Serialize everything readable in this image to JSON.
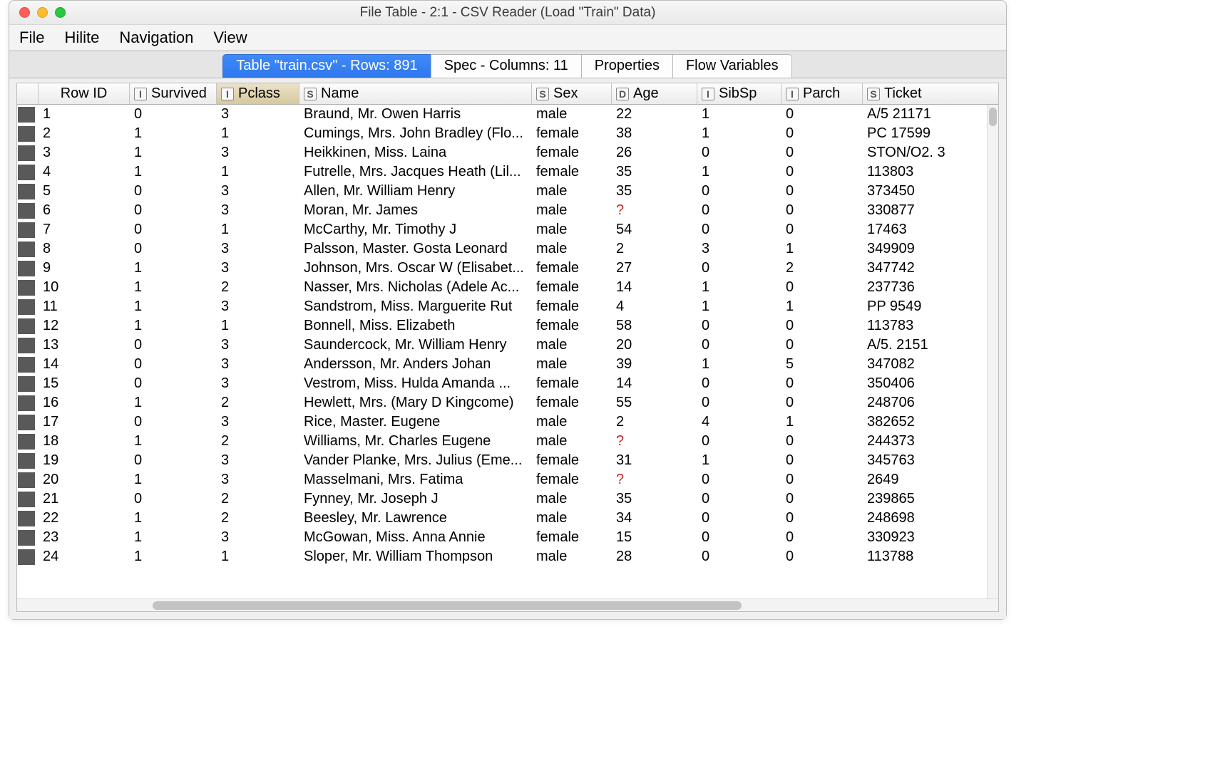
{
  "window": {
    "title": "File Table - 2:1 - CSV Reader (Load \"Train\" Data)"
  },
  "menubar": {
    "items": [
      "File",
      "Hilite",
      "Navigation",
      "View"
    ]
  },
  "tabs": [
    {
      "label": "Table \"train.csv\" - Rows: 891",
      "active": true
    },
    {
      "label": "Spec - Columns: 11",
      "active": false
    },
    {
      "label": "Properties",
      "active": false
    },
    {
      "label": "Flow Variables",
      "active": false
    }
  ],
  "columns": {
    "rowid": {
      "label": "Row ID"
    },
    "survived": {
      "type": "I",
      "label": "Survived"
    },
    "pclass": {
      "type": "I",
      "label": "Pclass",
      "sorted": true
    },
    "name": {
      "type": "S",
      "label": "Name"
    },
    "sex": {
      "type": "S",
      "label": "Sex"
    },
    "age": {
      "type": "D",
      "label": "Age"
    },
    "sibsp": {
      "type": "I",
      "label": "SibSp"
    },
    "parch": {
      "type": "I",
      "label": "Parch"
    },
    "ticket": {
      "type": "S",
      "label": "Ticket"
    }
  },
  "missing_marker": "?",
  "row_count": 891,
  "rows": [
    {
      "rowid": "1",
      "survived": "0",
      "pclass": "3",
      "name": "Braund, Mr. Owen Harris",
      "sex": "male",
      "age": "22",
      "sibsp": "1",
      "parch": "0",
      "ticket": "A/5 21171"
    },
    {
      "rowid": "2",
      "survived": "1",
      "pclass": "1",
      "name": "Cumings, Mrs. John Bradley (Flo...",
      "sex": "female",
      "age": "38",
      "sibsp": "1",
      "parch": "0",
      "ticket": "PC 17599"
    },
    {
      "rowid": "3",
      "survived": "1",
      "pclass": "3",
      "name": "Heikkinen, Miss. Laina",
      "sex": "female",
      "age": "26",
      "sibsp": "0",
      "parch": "0",
      "ticket": "STON/O2. 3"
    },
    {
      "rowid": "4",
      "survived": "1",
      "pclass": "1",
      "name": "Futrelle, Mrs. Jacques Heath (Lil...",
      "sex": "female",
      "age": "35",
      "sibsp": "1",
      "parch": "0",
      "ticket": "113803"
    },
    {
      "rowid": "5",
      "survived": "0",
      "pclass": "3",
      "name": "Allen, Mr. William Henry",
      "sex": "male",
      "age": "35",
      "sibsp": "0",
      "parch": "0",
      "ticket": "373450"
    },
    {
      "rowid": "6",
      "survived": "0",
      "pclass": "3",
      "name": "Moran, Mr. James",
      "sex": "male",
      "age": null,
      "sibsp": "0",
      "parch": "0",
      "ticket": "330877"
    },
    {
      "rowid": "7",
      "survived": "0",
      "pclass": "1",
      "name": "McCarthy, Mr. Timothy J",
      "sex": "male",
      "age": "54",
      "sibsp": "0",
      "parch": "0",
      "ticket": "17463"
    },
    {
      "rowid": "8",
      "survived": "0",
      "pclass": "3",
      "name": "Palsson, Master. Gosta Leonard",
      "sex": "male",
      "age": "2",
      "sibsp": "3",
      "parch": "1",
      "ticket": "349909"
    },
    {
      "rowid": "9",
      "survived": "1",
      "pclass": "3",
      "name": "Johnson, Mrs. Oscar W (Elisabet...",
      "sex": "female",
      "age": "27",
      "sibsp": "0",
      "parch": "2",
      "ticket": "347742"
    },
    {
      "rowid": "10",
      "survived": "1",
      "pclass": "2",
      "name": "Nasser, Mrs. Nicholas (Adele Ac...",
      "sex": "female",
      "age": "14",
      "sibsp": "1",
      "parch": "0",
      "ticket": "237736"
    },
    {
      "rowid": "11",
      "survived": "1",
      "pclass": "3",
      "name": "Sandstrom, Miss. Marguerite Rut",
      "sex": "female",
      "age": "4",
      "sibsp": "1",
      "parch": "1",
      "ticket": "PP 9549"
    },
    {
      "rowid": "12",
      "survived": "1",
      "pclass": "1",
      "name": "Bonnell, Miss. Elizabeth",
      "sex": "female",
      "age": "58",
      "sibsp": "0",
      "parch": "0",
      "ticket": "113783"
    },
    {
      "rowid": "13",
      "survived": "0",
      "pclass": "3",
      "name": "Saundercock, Mr. William Henry",
      "sex": "male",
      "age": "20",
      "sibsp": "0",
      "parch": "0",
      "ticket": "A/5. 2151"
    },
    {
      "rowid": "14",
      "survived": "0",
      "pclass": "3",
      "name": "Andersson, Mr. Anders Johan",
      "sex": "male",
      "age": "39",
      "sibsp": "1",
      "parch": "5",
      "ticket": "347082"
    },
    {
      "rowid": "15",
      "survived": "0",
      "pclass": "3",
      "name": "Vestrom, Miss. Hulda Amanda ...",
      "sex": "female",
      "age": "14",
      "sibsp": "0",
      "parch": "0",
      "ticket": "350406"
    },
    {
      "rowid": "16",
      "survived": "1",
      "pclass": "2",
      "name": "Hewlett, Mrs. (Mary D Kingcome)",
      "sex": "female",
      "age": "55",
      "sibsp": "0",
      "parch": "0",
      "ticket": "248706"
    },
    {
      "rowid": "17",
      "survived": "0",
      "pclass": "3",
      "name": "Rice, Master. Eugene",
      "sex": "male",
      "age": "2",
      "sibsp": "4",
      "parch": "1",
      "ticket": "382652"
    },
    {
      "rowid": "18",
      "survived": "1",
      "pclass": "2",
      "name": "Williams, Mr. Charles Eugene",
      "sex": "male",
      "age": null,
      "sibsp": "0",
      "parch": "0",
      "ticket": "244373"
    },
    {
      "rowid": "19",
      "survived": "0",
      "pclass": "3",
      "name": "Vander Planke, Mrs. Julius (Eme...",
      "sex": "female",
      "age": "31",
      "sibsp": "1",
      "parch": "0",
      "ticket": "345763"
    },
    {
      "rowid": "20",
      "survived": "1",
      "pclass": "3",
      "name": "Masselmani, Mrs. Fatima",
      "sex": "female",
      "age": null,
      "sibsp": "0",
      "parch": "0",
      "ticket": "2649"
    },
    {
      "rowid": "21",
      "survived": "0",
      "pclass": "2",
      "name": "Fynney, Mr. Joseph J",
      "sex": "male",
      "age": "35",
      "sibsp": "0",
      "parch": "0",
      "ticket": "239865"
    },
    {
      "rowid": "22",
      "survived": "1",
      "pclass": "2",
      "name": "Beesley, Mr. Lawrence",
      "sex": "male",
      "age": "34",
      "sibsp": "0",
      "parch": "0",
      "ticket": "248698"
    },
    {
      "rowid": "23",
      "survived": "1",
      "pclass": "3",
      "name": "McGowan, Miss. Anna Annie",
      "sex": "female",
      "age": "15",
      "sibsp": "0",
      "parch": "0",
      "ticket": "330923"
    },
    {
      "rowid": "24",
      "survived": "1",
      "pclass": "1",
      "name": "Sloper, Mr. William Thompson",
      "sex": "male",
      "age": "28",
      "sibsp": "0",
      "parch": "0",
      "ticket": "113788"
    }
  ]
}
